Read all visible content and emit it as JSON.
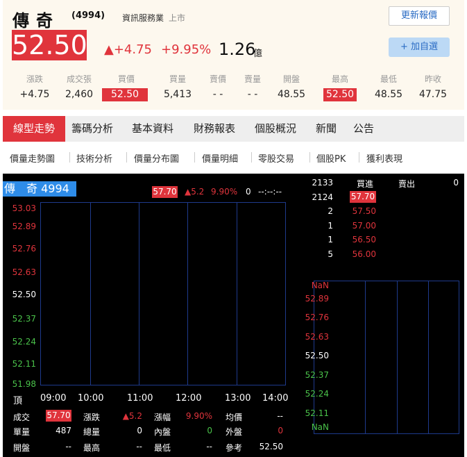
{
  "stock": {
    "name": "傳奇",
    "code": "(4994)",
    "industry": "資訊服務業",
    "market": "上市",
    "price": "52.50",
    "change": "▲+4.75",
    "change_pct": "+9.95%",
    "volume": "1.26",
    "volume_unit": "億"
  },
  "buttons": {
    "update": "更新報價",
    "add_watch": "+ 加自選"
  },
  "summary": {
    "headers": [
      "漲跌",
      "成交張",
      "買價",
      "買量",
      "賣價",
      "賣量",
      "開盤",
      "最高",
      "最低",
      "昨收"
    ],
    "values": [
      "+4.75",
      "2,460",
      "52.50",
      "5,413",
      "- -",
      "- -",
      "48.55",
      "52.50",
      "48.55",
      "47.75"
    ]
  },
  "tabs": [
    "線型走勢",
    "籌碼分析",
    "基本資料",
    "財務報表",
    "個股概況",
    "新聞",
    "公告"
  ],
  "subtabs": [
    "價量走勢圖",
    "技術分析",
    "價量分布圖",
    "價量明細",
    "零股交易",
    "個股PK",
    "獲利表現"
  ],
  "chart": {
    "title": "傳　奇 4994",
    "last": "57.70",
    "delta": "▲5.2",
    "pct": "9.90%",
    "vol": "0",
    "time": "--:--:--",
    "yticks": [
      "53.03",
      "52.89",
      "52.76",
      "52.63",
      "52.50",
      "52.37",
      "52.24",
      "52.11",
      "51.98"
    ],
    "xticks": [
      "頂",
      "09:00",
      "10:00",
      "11:00",
      "12:00",
      "13:00",
      "14:00"
    ]
  },
  "bottom": {
    "r1": {
      "l1": "成交",
      "v1": "57.70",
      "l2": "漲跌",
      "v2": "▲5.2",
      "l3": "漲幅",
      "v3": "9.90%",
      "l4": "均價",
      "v4": "--"
    },
    "r2": {
      "l1": "單量",
      "v1": "487",
      "l2": "總量",
      "v2": "0",
      "l3": "內盤",
      "v3": "0",
      "l4": "外盤",
      "v4": "0"
    },
    "r3": {
      "l1": "開盤",
      "v1": "--",
      "l2": "最高",
      "v2": "--",
      "l3": "最低",
      "v3": "--",
      "l4": "參考",
      "v4": "52.50"
    }
  },
  "orderbook": {
    "head_left": "2133",
    "head_buy": "買進",
    "head_sell": "賣出",
    "head_right": "0",
    "rows": [
      {
        "q": "2124",
        "p": "57.70"
      },
      {
        "q": "2",
        "p": "57.50"
      },
      {
        "q": "1",
        "p": "57.00"
      },
      {
        "q": "1",
        "p": "56.50"
      },
      {
        "q": "5",
        "p": "56.00"
      }
    ]
  },
  "minichart": {
    "yticks": [
      "NaN",
      "52.89",
      "52.76",
      "52.63",
      "52.50",
      "52.37",
      "52.24",
      "52.11",
      "NaN"
    ]
  }
}
